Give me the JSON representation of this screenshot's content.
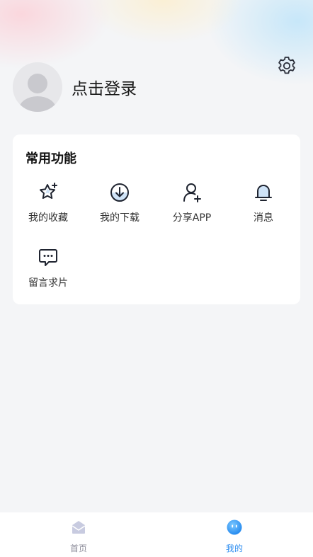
{
  "profile": {
    "login_label": "点击登录"
  },
  "common_functions": {
    "title": "常用功能",
    "items": [
      {
        "label": "我的收藏",
        "icon": "star-icon"
      },
      {
        "label": "我的下载",
        "icon": "download-icon"
      },
      {
        "label": "分享APP",
        "icon": "add-user-icon"
      },
      {
        "label": "消息",
        "icon": "bell-icon"
      },
      {
        "label": "留言求片",
        "icon": "chat-bubble-icon"
      }
    ]
  },
  "tabbar": {
    "tabs": [
      {
        "label": "首页",
        "icon": "home-icon",
        "active": false
      },
      {
        "label": "我的",
        "icon": "profile-face-icon",
        "active": true
      }
    ],
    "active_color": "#2a8cf0",
    "inactive_color": "#8c8c99"
  }
}
